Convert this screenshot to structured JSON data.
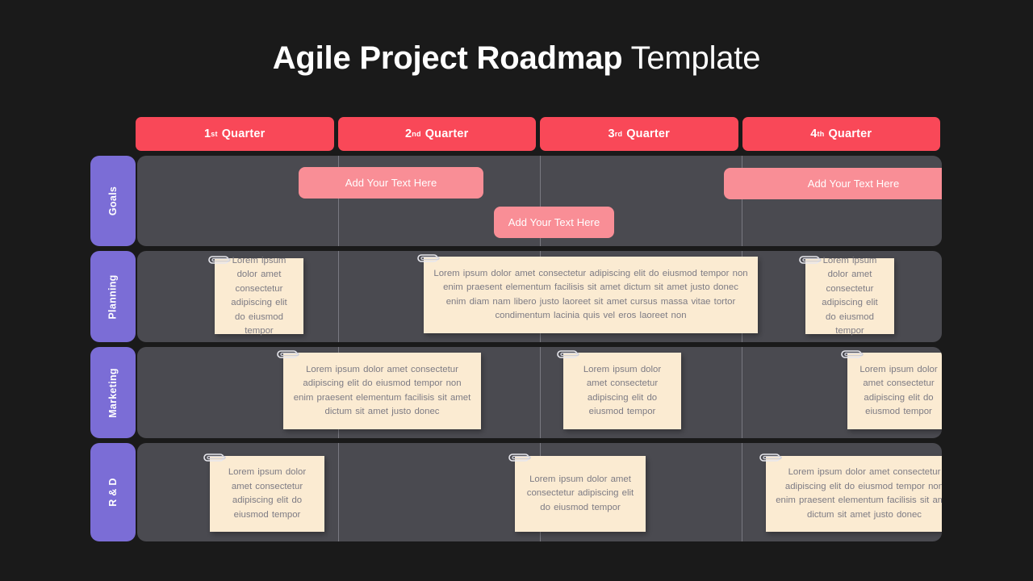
{
  "title": {
    "strong": "Agile Project Roadmap",
    "light": " Template"
  },
  "colors": {
    "background": "#1a1a1a",
    "quarter_red": "#F94858",
    "row_tab_purple": "#7B6DD6",
    "row_body": "#4A4A50",
    "pink_box": "#F98E96",
    "sticky_note": "#FBEBD2",
    "note_text": "#7d7b84"
  },
  "quarters": [
    {
      "ordinal": "1",
      "suffix": "st",
      "label": "Quarter"
    },
    {
      "ordinal": "2",
      "suffix": "nd",
      "label": "Quarter"
    },
    {
      "ordinal": "3",
      "suffix": "rd",
      "label": "Quarter"
    },
    {
      "ordinal": "4",
      "suffix": "th",
      "label": "Quarter"
    }
  ],
  "rows": {
    "goals": {
      "label": "Goals",
      "boxes": [
        {
          "text": "Add Your Text Here"
        },
        {
          "text": "Add Your Text Here"
        },
        {
          "text": "Add Your Text Here"
        }
      ]
    },
    "planning": {
      "label": "Planning",
      "notes": [
        {
          "text": "Lorem  ipsum dolor amet consectetur adipiscing elit do eiusmod tempor"
        },
        {
          "text": "Lorem  ipsum dolor  amet consectetur  adipiscing elit do eiusmod tempor non enim praesent elementum  facilisis sit amet dictum sit amet  justo donec enim  diam nam  libero justo laoreet sit amet cursus massa vitae tortor condimentum  lacinia quis vel eros laoreet non"
        },
        {
          "text": "Lorem  ipsum dolor amet consectetur adipiscing elit do eiusmod tempor"
        }
      ]
    },
    "marketing": {
      "label": "Marketing",
      "notes": [
        {
          "text": "Lorem  ipsum dolor  amet consectetur adipiscing elit do eiusmod tempor  non enim praesent elementum  facilisis sit amet dictum sit amet  justo donec"
        },
        {
          "text": "Lorem  ipsum dolor amet consectetur adipiscing elit do eiusmod tempor"
        },
        {
          "text": "Lorem  ipsum dolor amet consectetur adipiscing elit do eiusmod tempor"
        }
      ]
    },
    "rnd": {
      "label": "R & D",
      "notes": [
        {
          "text": "Lorem  ipsum dolor amet consectetur adipiscing elit do eiusmod tempor"
        },
        {
          "text": "Lorem  ipsum dolor  amet consectetur adipiscing elit do eiusmod tempor"
        },
        {
          "text": "Lorem  ipsum dolor  amet consectetur adipiscing elit do eiusmod tempor  non enim praesent elementum  facilisis sit amet dictum sit amet justo donec"
        }
      ]
    }
  },
  "icons": {
    "paperclip": "paperclip-icon"
  }
}
